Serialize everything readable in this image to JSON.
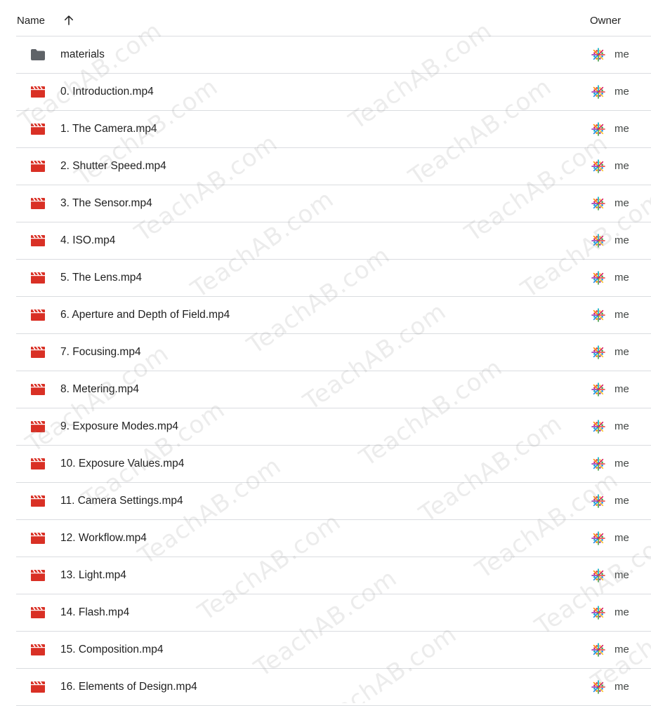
{
  "header": {
    "name_label": "Name",
    "sort_icon": "arrow-up-icon",
    "owner_label": "Owner"
  },
  "colors": {
    "folder": "#5f6368",
    "video": "#d93025",
    "divider": "#dadce0"
  },
  "files": [
    {
      "name": "materials",
      "type": "folder",
      "owner": "me"
    },
    {
      "name": "0. Introduction.mp4",
      "type": "video",
      "owner": "me"
    },
    {
      "name": "1. The Camera.mp4",
      "type": "video",
      "owner": "me"
    },
    {
      "name": "2. Shutter Speed.mp4",
      "type": "video",
      "owner": "me"
    },
    {
      "name": "3. The Sensor.mp4",
      "type": "video",
      "owner": "me"
    },
    {
      "name": "4. ISO.mp4",
      "type": "video",
      "owner": "me"
    },
    {
      "name": "5. The Lens.mp4",
      "type": "video",
      "owner": "me"
    },
    {
      "name": "6. Aperture and Depth of Field.mp4",
      "type": "video",
      "owner": "me"
    },
    {
      "name": "7. Focusing.mp4",
      "type": "video",
      "owner": "me"
    },
    {
      "name": "8. Metering.mp4",
      "type": "video",
      "owner": "me"
    },
    {
      "name": "9. Exposure Modes.mp4",
      "type": "video",
      "owner": "me"
    },
    {
      "name": "10. Exposure Values.mp4",
      "type": "video",
      "owner": "me"
    },
    {
      "name": "11. Camera Settings.mp4",
      "type": "video",
      "owner": "me"
    },
    {
      "name": "12. Workflow.mp4",
      "type": "video",
      "owner": "me"
    },
    {
      "name": "13. Light.mp4",
      "type": "video",
      "owner": "me"
    },
    {
      "name": "14. Flash.mp4",
      "type": "video",
      "owner": "me"
    },
    {
      "name": "15. Composition.mp4",
      "type": "video",
      "owner": "me"
    },
    {
      "name": "16. Elements of Design.mp4",
      "type": "video",
      "owner": "me"
    }
  ],
  "watermark": "TeachAB.com"
}
